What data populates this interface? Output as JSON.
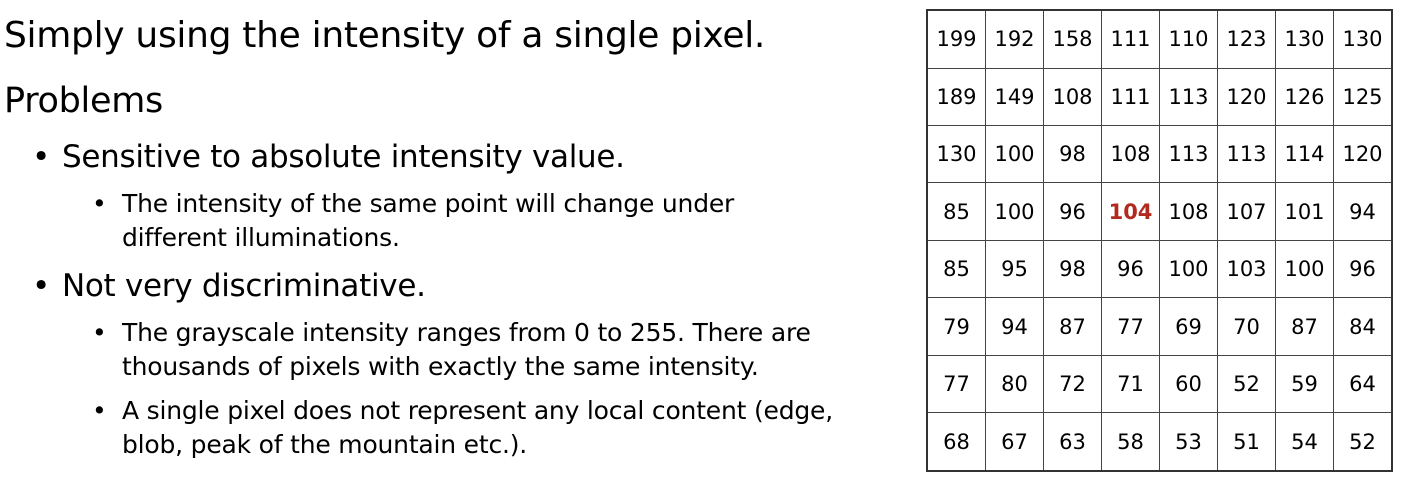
{
  "slide": {
    "title": "Simply using the intensity of a single pixel.",
    "problems_heading": "Problems",
    "bullets": [
      {
        "text": "Sensitive to absolute intensity value.",
        "sub": [
          {
            "line1": "The intensity of the same point will change under",
            "line2": "different illuminations."
          }
        ]
      },
      {
        "text": "Not very discriminative.",
        "sub": [
          {
            "line1": "The grayscale intensity ranges from 0 to 255. There are",
            "line2": "thousands of pixels with exactly the same intensity."
          },
          {
            "line1": "A single pixel does not represent any local content (edge,",
            "line2": "blob, peak of the mountain etc.)."
          }
        ]
      }
    ],
    "bullet_glyph": "•"
  },
  "grid": {
    "rows": [
      [
        "199",
        "192",
        "158",
        "111",
        "110",
        "123",
        "130",
        "130"
      ],
      [
        "189",
        "149",
        "108",
        "111",
        "113",
        "120",
        "126",
        "125"
      ],
      [
        "130",
        "100",
        "98",
        "108",
        "113",
        "113",
        "114",
        "120"
      ],
      [
        "85",
        "100",
        "96",
        "104",
        "108",
        "107",
        "101",
        "94"
      ],
      [
        "85",
        "95",
        "98",
        "96",
        "100",
        "103",
        "100",
        "96"
      ],
      [
        "79",
        "94",
        "87",
        "77",
        "69",
        "70",
        "87",
        "84"
      ],
      [
        "77",
        "80",
        "72",
        "71",
        "60",
        "52",
        "59",
        "64"
      ],
      [
        "68",
        "67",
        "63",
        "58",
        "53",
        "51",
        "54",
        "52"
      ]
    ],
    "highlight": {
      "row": 3,
      "col": 3
    },
    "highlight_color": "#b22a1f"
  }
}
